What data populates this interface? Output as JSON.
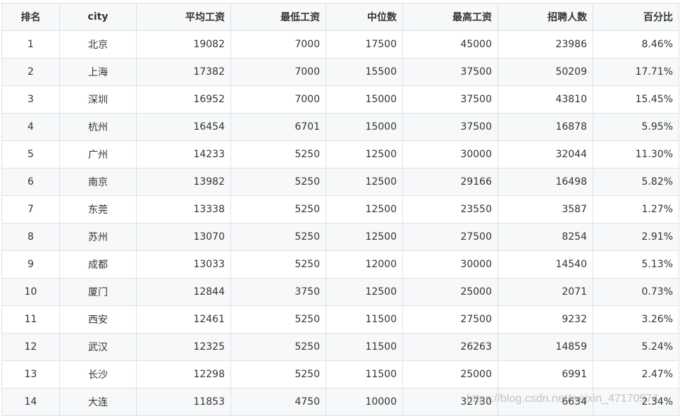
{
  "table": {
    "headers": {
      "rank": "排名",
      "city": "city",
      "avg_salary": "平均工资",
      "min_salary": "最低工资",
      "median": "中位数",
      "max_salary": "最高工资",
      "hires": "招聘人数",
      "percent": "百分比"
    },
    "rows": [
      {
        "rank": "1",
        "city": "北京",
        "avg": "19082",
        "min": "7000",
        "median": "17500",
        "max": "45000",
        "hires": "23986",
        "pct": "8.46%"
      },
      {
        "rank": "2",
        "city": "上海",
        "avg": "17382",
        "min": "7000",
        "median": "15500",
        "max": "37500",
        "hires": "50209",
        "pct": "17.71%"
      },
      {
        "rank": "3",
        "city": "深圳",
        "avg": "16952",
        "min": "7000",
        "median": "15000",
        "max": "37500",
        "hires": "43810",
        "pct": "15.45%"
      },
      {
        "rank": "4",
        "city": "杭州",
        "avg": "16454",
        "min": "6701",
        "median": "15000",
        "max": "37500",
        "hires": "16878",
        "pct": "5.95%"
      },
      {
        "rank": "5",
        "city": "广州",
        "avg": "14233",
        "min": "5250",
        "median": "12500",
        "max": "30000",
        "hires": "32044",
        "pct": "11.30%"
      },
      {
        "rank": "6",
        "city": "南京",
        "avg": "13982",
        "min": "5250",
        "median": "12500",
        "max": "29166",
        "hires": "16498",
        "pct": "5.82%"
      },
      {
        "rank": "7",
        "city": "东莞",
        "avg": "13338",
        "min": "5250",
        "median": "12500",
        "max": "23550",
        "hires": "3587",
        "pct": "1.27%"
      },
      {
        "rank": "8",
        "city": "苏州",
        "avg": "13070",
        "min": "5250",
        "median": "12500",
        "max": "27500",
        "hires": "8254",
        "pct": "2.91%"
      },
      {
        "rank": "9",
        "city": "成都",
        "avg": "13033",
        "min": "5250",
        "median": "12000",
        "max": "30000",
        "hires": "14540",
        "pct": "5.13%"
      },
      {
        "rank": "10",
        "city": "厦门",
        "avg": "12844",
        "min": "3750",
        "median": "12500",
        "max": "25000",
        "hires": "2071",
        "pct": "0.73%"
      },
      {
        "rank": "11",
        "city": "西安",
        "avg": "12461",
        "min": "5250",
        "median": "11500",
        "max": "27500",
        "hires": "9232",
        "pct": "3.26%"
      },
      {
        "rank": "12",
        "city": "武汉",
        "avg": "12325",
        "min": "5250",
        "median": "11500",
        "max": "26263",
        "hires": "14859",
        "pct": "5.24%"
      },
      {
        "rank": "13",
        "city": "长沙",
        "avg": "12298",
        "min": "5250",
        "median": "11500",
        "max": "25000",
        "hires": "6991",
        "pct": "2.47%"
      },
      {
        "rank": "14",
        "city": "大连",
        "avg": "11853",
        "min": "4750",
        "median": "10000",
        "max": "32730",
        "hires": "6634",
        "pct": "2.34%"
      }
    ]
  },
  "watermark": "https://blog.csdn.net/weixin_47170974"
}
